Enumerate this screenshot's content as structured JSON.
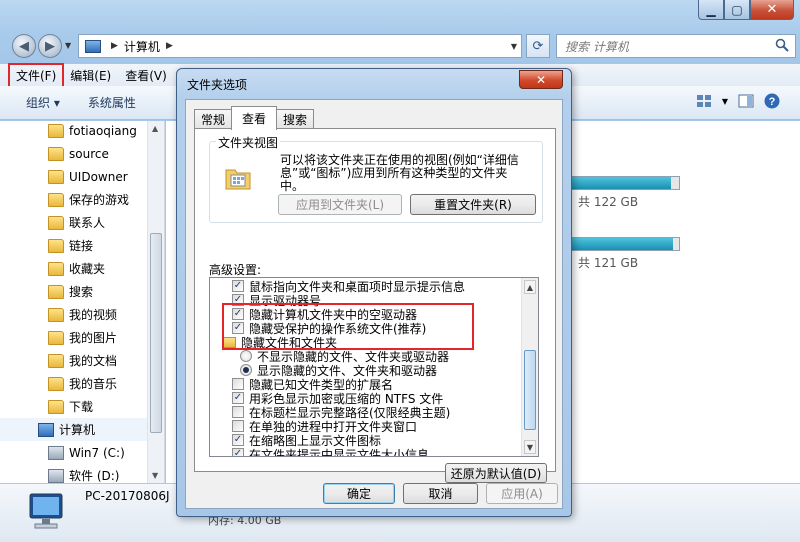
{
  "explorer": {
    "address": {
      "location": "计算机"
    },
    "search": {
      "placeholder": "搜索 计算机"
    },
    "menu": [
      {
        "label": "文件(F)"
      },
      {
        "label": "编辑(E)"
      },
      {
        "label": "查看(V)"
      }
    ],
    "toolbar": {
      "organize": "组织 ▾",
      "system_props": "系统属性"
    },
    "sidebar": [
      {
        "label": "fotiaoqiang",
        "icon": "folder-icon"
      },
      {
        "label": "source",
        "icon": "folder-icon"
      },
      {
        "label": "UIDowner",
        "icon": "folder-icon"
      },
      {
        "label": "保存的游戏",
        "icon": "games-folder-icon"
      },
      {
        "label": "联系人",
        "icon": "contacts-folder-icon"
      },
      {
        "label": "链接",
        "icon": "links-folder-icon"
      },
      {
        "label": "收藏夹",
        "icon": "favorites-folder-icon"
      },
      {
        "label": "搜索",
        "icon": "search-folder-icon"
      },
      {
        "label": "我的视频",
        "icon": "videos-folder-icon"
      },
      {
        "label": "我的图片",
        "icon": "pictures-folder-icon"
      },
      {
        "label": "我的文档",
        "icon": "documents-folder-icon"
      },
      {
        "label": "我的音乐",
        "icon": "music-folder-icon"
      },
      {
        "label": "下载",
        "icon": "downloads-folder-icon"
      },
      {
        "label": "计算机",
        "icon": "computer-icon"
      },
      {
        "label": "Win7 (C:)",
        "icon": "drive-icon"
      },
      {
        "label": "软件 (D:)",
        "icon": "drive-icon"
      }
    ],
    "drives": [
      {
        "free_text": "共 122 GB",
        "used_fraction": 0.93
      },
      {
        "free_text": "共 121 GB",
        "used_fraction": 0.95
      }
    ],
    "details": {
      "pc_name": "PC-20170806J",
      "memory": "内存: 4.00 GB"
    }
  },
  "dialog": {
    "title": "文件夹选项",
    "close_glyph": "✕",
    "tabs": [
      {
        "label": "常规",
        "active": false
      },
      {
        "label": "查看",
        "active": true
      },
      {
        "label": "搜索",
        "active": false
      }
    ],
    "folder_views": {
      "group_label": "文件夹视图",
      "description": "可以将该文件夹正在使用的视图(例如“详细信息”或“图标”)应用到所有这种类型的文件夹中。",
      "apply_button": "应用到文件夹(L)",
      "reset_button": "重置文件夹(R)"
    },
    "advanced": {
      "label": "高级设置:",
      "items": [
        {
          "type": "checkbox",
          "checked": true,
          "label": "鼠标指向文件夹和桌面项时显示提示信息"
        },
        {
          "type": "checkbox",
          "checked": true,
          "label": "显示驱动器号"
        },
        {
          "type": "checkbox",
          "checked": true,
          "label": "隐藏计算机文件夹中的空驱动器"
        },
        {
          "type": "checkbox",
          "checked": true,
          "label": "隐藏受保护的操作系统文件(推荐)"
        },
        {
          "type": "folder",
          "label": "隐藏文件和文件夹"
        },
        {
          "type": "radio",
          "checked": false,
          "label": "不显示隐藏的文件、文件夹或驱动器"
        },
        {
          "type": "radio",
          "checked": true,
          "label": "显示隐藏的文件、文件夹和驱动器"
        },
        {
          "type": "checkbox",
          "checked": false,
          "label": "隐藏已知文件类型的扩展名"
        },
        {
          "type": "checkbox",
          "checked": true,
          "label": "用彩色显示加密或压缩的 NTFS 文件"
        },
        {
          "type": "checkbox",
          "checked": false,
          "label": "在标题栏显示完整路径(仅限经典主题)"
        },
        {
          "type": "checkbox",
          "checked": false,
          "label": "在单独的进程中打开文件夹窗口"
        },
        {
          "type": "checkbox",
          "checked": true,
          "label": "在缩略图上显示文件图标"
        },
        {
          "type": "checkbox",
          "checked": true,
          "label": "在文件夹提示中显示文件大小信息"
        }
      ],
      "restore_button": "还原为默认值(D)"
    },
    "footer": {
      "ok": "确定",
      "cancel": "取消",
      "apply": "应用(A)"
    },
    "highlight_color": "#e4262c"
  }
}
